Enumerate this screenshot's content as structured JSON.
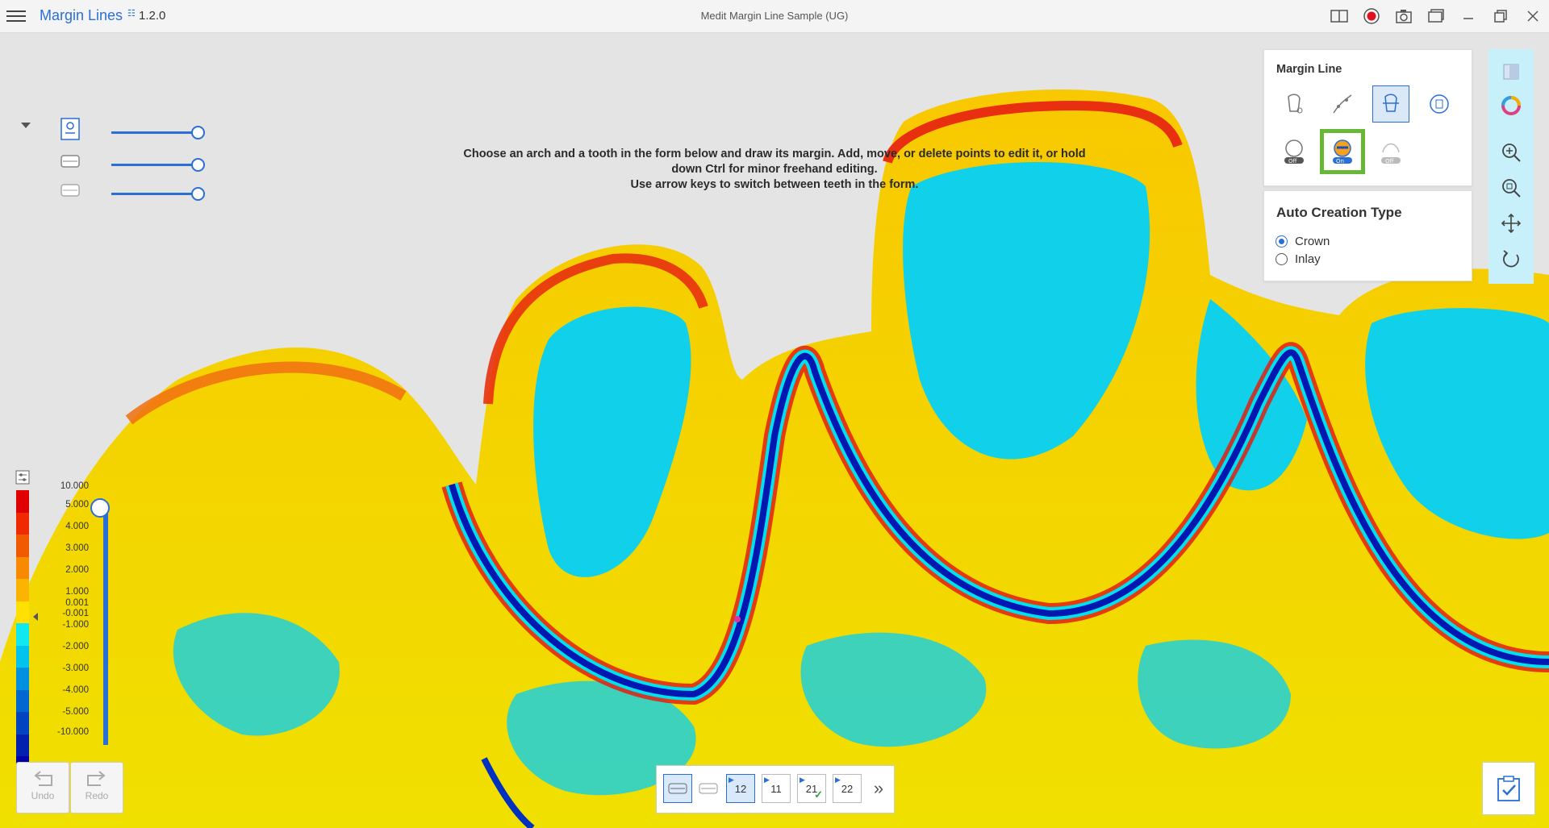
{
  "app": {
    "name": "Margin Lines",
    "version": "1.2.0",
    "window_title": "Medit Margin Line Sample (UG)"
  },
  "instruction": {
    "line1": "Choose an arch and a tooth in the form below and draw its margin. Add, move, or delete points to edit it, or hold",
    "line2": "down Ctrl for minor freehand editing.",
    "line3": "Use arrow keys to switch between teeth in the form."
  },
  "layers": [
    {
      "icon": "document-icon",
      "opacity": 1.0
    },
    {
      "icon": "upper-arch-icon",
      "opacity": 1.0
    },
    {
      "icon": "lower-arch-icon",
      "opacity": 1.0
    }
  ],
  "margin_line_panel": {
    "title": "Margin Line",
    "tools": [
      {
        "name": "manual-draw-tool",
        "active": false
      },
      {
        "name": "edit-points-tool",
        "active": false
      },
      {
        "name": "auto-creation-tool",
        "active": true
      },
      {
        "name": "delete-margin-tool",
        "active": false
      },
      {
        "name": "undercut-toggle",
        "state": "Off"
      },
      {
        "name": "deviation-map-toggle",
        "state": "On"
      },
      {
        "name": "smooth-toggle",
        "state": "Off"
      }
    ]
  },
  "auto_creation": {
    "title": "Auto Creation Type",
    "options": [
      "Crown",
      "Inlay"
    ],
    "selected": "Crown"
  },
  "legend": {
    "labels": [
      "10.000",
      "5.000",
      "4.000",
      "3.000",
      "2.000",
      "1.000",
      "0.001",
      "-0.001",
      "-1.000",
      "-2.000",
      "-3.000",
      "-4.000",
      "-5.000",
      "-10.000"
    ],
    "colors": [
      "#e10000",
      "#f02a00",
      "#f25a00",
      "#f78a00",
      "#fbb500",
      "#ffe000",
      "#10e8f0",
      "#00c4ee",
      "#0090e0",
      "#0066d0",
      "#0044c0",
      "#0020b0",
      "#0000a8"
    ]
  },
  "bottom": {
    "undo_label": "Undo",
    "redo_label": "Redo",
    "teeth": [
      {
        "label": "12",
        "active": true,
        "done": false
      },
      {
        "label": "11",
        "active": false,
        "done": false
      },
      {
        "label": "21",
        "active": false,
        "done": true
      },
      {
        "label": "22",
        "active": false,
        "done": false
      }
    ],
    "more": "»"
  },
  "colors": {
    "accent": "#2a6fd6",
    "highlight": "#68b838",
    "toolbar_bg": "#c7f0fb"
  }
}
